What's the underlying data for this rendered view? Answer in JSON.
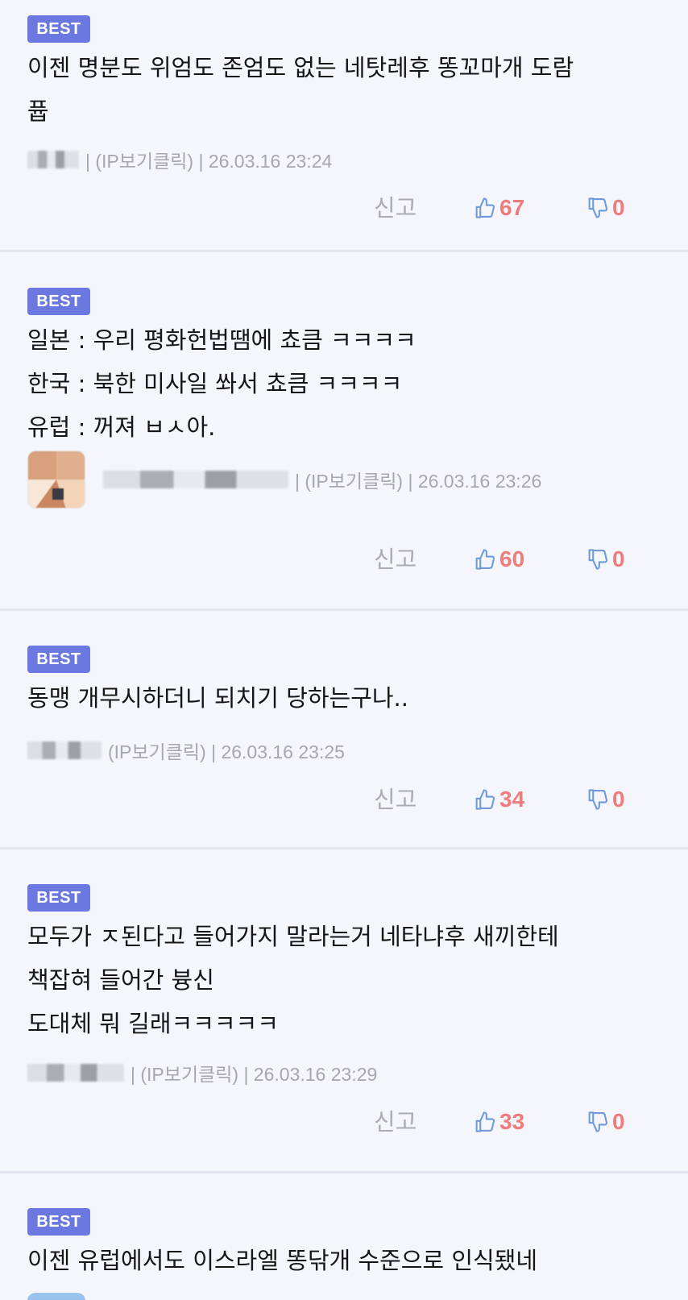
{
  "badge_label": "BEST",
  "report_label": "신고",
  "comments": [
    {
      "body": "이젠 명분도 위엄도 존엄도 없는 네탓레후 똥꼬마개 도람\n퓹",
      "meta": "| (IP보기클릭) | 26.03.16 23:24",
      "likes": "67",
      "dislikes": "0"
    },
    {
      "body": "일본 : 우리 평화헌법땜에 쵸큼 ㅋㅋㅋㅋ\n한국 : 북한 미사일 쏴서 쵸큼 ㅋㅋㅋㅋ\n유럽 : 꺼져 ㅂㅅ아.",
      "meta": "| (IP보기클릭) | 26.03.16 23:26",
      "likes": "60",
      "dislikes": "0"
    },
    {
      "body": "동맹 개무시하더니 되치기 당하는구나..",
      "meta": "(IP보기클릭) | 26.03.16 23:25",
      "likes": "34",
      "dislikes": "0"
    },
    {
      "body": "모두가 ㅈ된다고 들어가지 말라는거 네타냐후 새끼한테\n책잡혀 들어간 븅신\n도대체 뭐 길래ㅋㅋㅋㅋㅋ",
      "meta": "| (IP보기클릭) | 26.03.16 23:29",
      "likes": "33",
      "dislikes": "0"
    },
    {
      "body": "이젠 유럽에서도 이스라엘 똥닦개 수준으로 인식됐네"
    }
  ],
  "colors": {
    "badge": "#6b78e0",
    "count": "#ef7c7c",
    "thumb": "#6f9ad9",
    "muted": "#a4a7ae",
    "background": "#f4f6fb"
  }
}
